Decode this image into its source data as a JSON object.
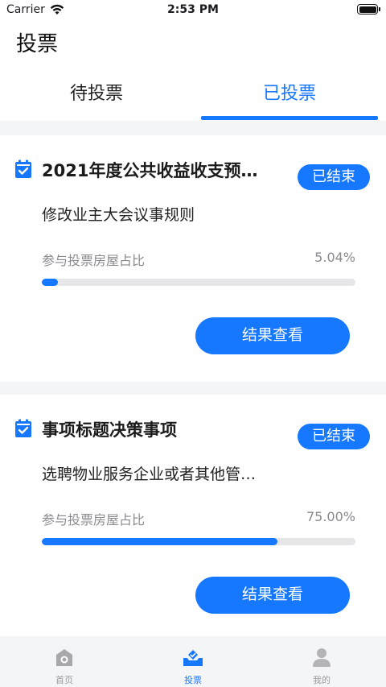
{
  "status_bar": {
    "carrier": "Carrier",
    "time": "2:53 PM"
  },
  "header": {
    "title": "投票"
  },
  "tabs": [
    {
      "label": "待投票",
      "active": false
    },
    {
      "label": "已投票",
      "active": true
    }
  ],
  "cards": [
    {
      "title": "2021年度公共收益收支预…",
      "status": "已结束",
      "subtitle": "修改业主大会议事规则",
      "ratio_label": "参与投票房屋占比",
      "ratio_value": "5.04%",
      "progress": 0.0504,
      "button_label": "结果查看"
    },
    {
      "title": "事项标题决策事项",
      "status": "已结束",
      "subtitle": "选聘物业服务企业或者其他管…",
      "ratio_label": "参与投票房屋占比",
      "ratio_value": "75.00%",
      "progress": 0.75,
      "button_label": "结果查看"
    }
  ],
  "bottom_nav": [
    {
      "label": "首页",
      "icon": "home-icon",
      "active": false
    },
    {
      "label": "投票",
      "icon": "ballot-icon",
      "active": true
    },
    {
      "label": "我的",
      "icon": "profile-icon",
      "active": false
    }
  ],
  "colors": {
    "accent": "#1677ff",
    "inactive": "#9a9a9e",
    "background": "#f4f5f7"
  }
}
